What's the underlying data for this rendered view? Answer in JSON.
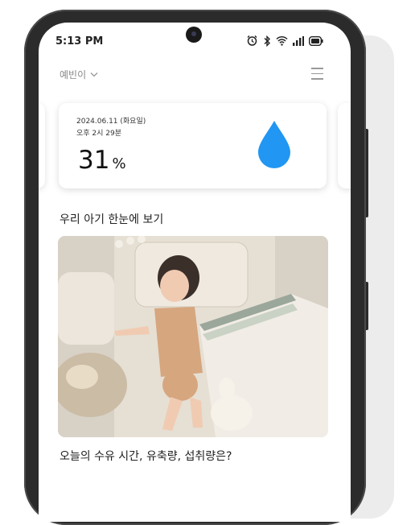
{
  "status_bar": {
    "time": "5:13 PM",
    "icons": [
      "alarm-icon",
      "bluetooth-icon",
      "wifi-icon",
      "signal-icon",
      "battery-icon"
    ]
  },
  "header": {
    "profile_name": "예빈이",
    "menu_icon": "hamburger-menu-icon"
  },
  "humidity_card": {
    "date": "2024.06.11 (화요일)",
    "time": "오후 2시 29분",
    "value": "31",
    "unit": "%",
    "icon": "water-drop-icon",
    "icon_color": "#2196F3"
  },
  "section": {
    "title": "우리 아기 한눈에 보기"
  },
  "photo": {
    "icon": "baby-photo"
  },
  "feeding": {
    "question": "오늘의 수유 시간, 유축량, 섭취량은?"
  }
}
